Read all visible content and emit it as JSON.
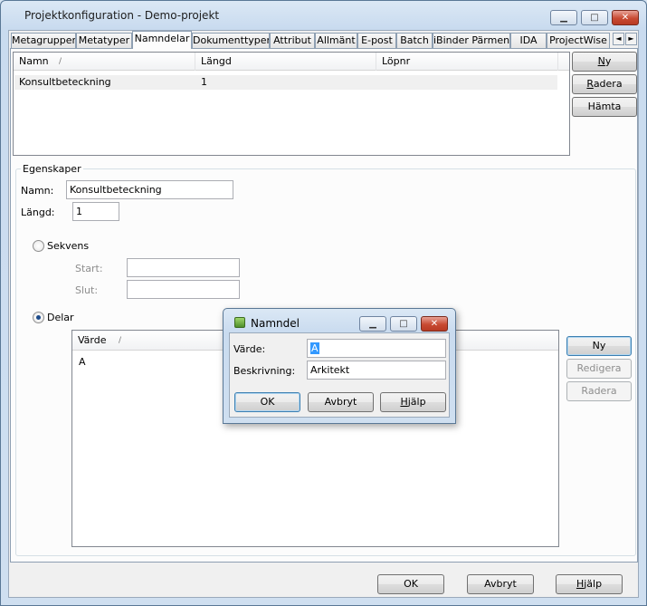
{
  "window": {
    "title": "Projektkonfiguration - Demo-projekt",
    "minimize": "▁",
    "maximize": "□",
    "close": "✕"
  },
  "tabs": [
    {
      "label": "Metagrupper"
    },
    {
      "label": "Metatyper"
    },
    {
      "label": "Namndelar"
    },
    {
      "label": "Dokumenttyper"
    },
    {
      "label": "Attribut"
    },
    {
      "label": "Allmänt"
    },
    {
      "label": "E-post"
    },
    {
      "label": "Batch"
    },
    {
      "label": "iBinder Pärmen"
    },
    {
      "label": "IDA"
    },
    {
      "label": "ProjectWise"
    }
  ],
  "tab_scroll": {
    "left": "◄",
    "right": "►"
  },
  "active_tab": "Namndelar",
  "namndelar_list": {
    "columns": [
      "Namn",
      "Längd",
      "Löpnr"
    ],
    "rows": [
      {
        "namn": "Konsultbeteckning",
        "langd": "1",
        "lopnr": ""
      }
    ],
    "sort_indicator": "/"
  },
  "list_buttons": {
    "ny": {
      "pre": "",
      "key": "N",
      "post": "y"
    },
    "radera": {
      "pre": "",
      "key": "R",
      "post": "adera"
    },
    "hamta": "Hämta"
  },
  "egenskaper": {
    "legend": "Egenskaper",
    "namn_label": "Namn:",
    "namn_value": "Konsultbeteckning",
    "langd_label": "Längd:",
    "langd_value": "1",
    "sekvens_label": "Sekvens",
    "sekvens_selected": false,
    "start_label": "Start:",
    "start_value": "",
    "slut_label": "Slut:",
    "slut_value": "",
    "delar_label": "Delar",
    "delar_selected": true
  },
  "delar_list": {
    "columns": [
      "Värde"
    ],
    "sort_indicator": "/",
    "rows": [
      {
        "varde": "A"
      }
    ]
  },
  "delar_buttons": {
    "ny": "Ny",
    "redigera": "Redigera",
    "radera": "Radera"
  },
  "footer_buttons": {
    "ok": "OK",
    "avbryt": "Avbryt",
    "hjalp": {
      "pre": "",
      "key": "H",
      "post": "jälp"
    }
  },
  "dialog": {
    "title": "Namndel",
    "varde_label": "Värde:",
    "varde_value": "A",
    "beskrivning_label": "Beskrivning:",
    "beskrivning_value": "Arkitekt",
    "ok": "OK",
    "avbryt": "Avbryt",
    "hjalp": {
      "pre": "",
      "key": "H",
      "post": "jälp"
    }
  }
}
